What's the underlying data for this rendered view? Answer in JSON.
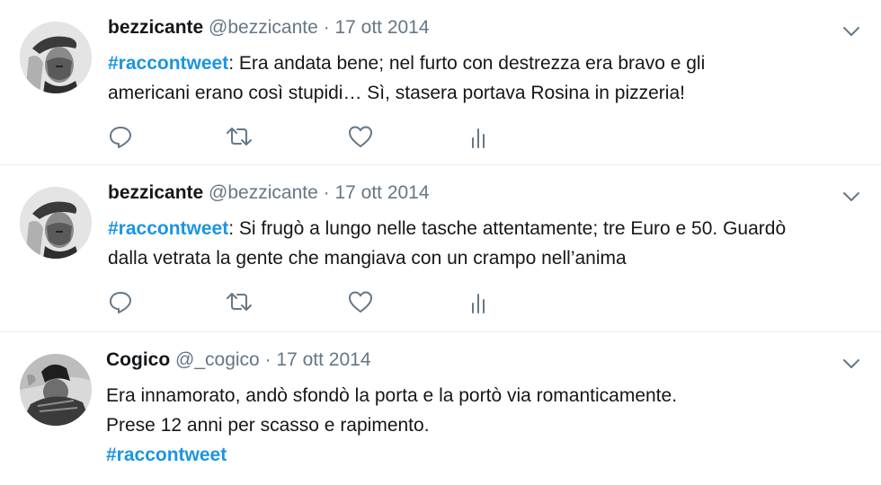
{
  "tweets": [
    {
      "name": "bezzicante",
      "handle": "@bezzicante",
      "separator": "·",
      "date": "17 ott 2014",
      "hashtag": "#raccontweet",
      "line1_rest": ": Era andata bene; nel furto con destrezza era bravo e gli",
      "line2": "americani erano così stupidi… Sì, stasera portava Rosina in pizzeria!"
    },
    {
      "name": "bezzicante",
      "handle": "@bezzicante",
      "separator": "·",
      "date": "17 ott 2014",
      "hashtag": "#raccontweet",
      "line1_rest": ": Si frugò a lungo nelle tasche attentamente; tre Euro e 50. Guardò",
      "line2": "dalla vetrata la gente che mangiava con un crampo nell’anima"
    },
    {
      "name": "Cogico",
      "handle": "@_cogico",
      "separator": "·",
      "date": "17 ott 2014",
      "line1": "Era innamorato, andò sfondò la porta e la portò via romanticamente.",
      "line2": "Prese 12 anni per scasso e rapimento.",
      "hashtag": "#raccontweet"
    }
  ],
  "icons": {
    "reply": "reply-icon",
    "retweet": "retweet-icon",
    "like": "heart-icon",
    "stats": "analytics-icon",
    "menu": "chevron-down-icon"
  },
  "colors": {
    "hashtag": "#1b95e0",
    "muted": "#657786",
    "text": "#14171a",
    "divider": "#e6ecf0"
  }
}
